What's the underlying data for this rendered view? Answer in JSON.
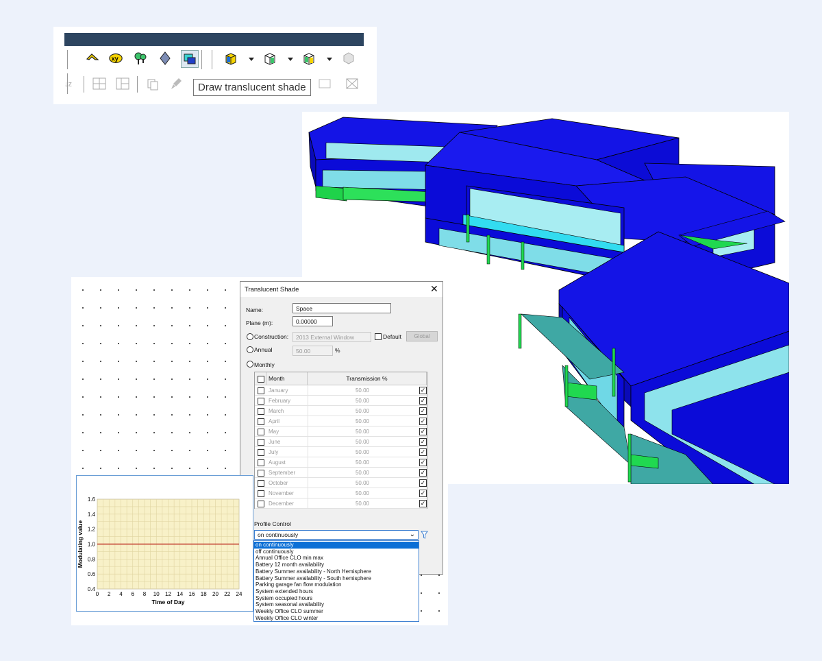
{
  "toolbar": {
    "tooltip": "Draw translucent shade",
    "icons": [
      "arrow-tool-icon",
      "xy-coordinate-icon",
      "tree-icon",
      "shade-diamond-icon",
      "translucent-shade-icon",
      "component-icon",
      "component-icon",
      "component-icon",
      "disabled-component-icon",
      "sort-icon",
      "layout-icon",
      "layout-icon",
      "copy-icon",
      "paint-icon",
      "tile-icon",
      "frame-icon"
    ]
  },
  "dialog": {
    "title": "Translucent Shade",
    "name_label": "Name:",
    "name_value": "Space",
    "plane_label": "Plane (m):",
    "plane_value": "0.00000",
    "construction_label": "Construction:",
    "construction_value": "2013 External Window",
    "default_label": "Default",
    "global_button": "Global",
    "annual_label": "Annual",
    "annual_value": "50.00",
    "percent_unit": "%",
    "monthly_label": "Monthly",
    "table_headers": {
      "month": "Month",
      "transmission": "Transmission %"
    },
    "months": [
      {
        "name": "January",
        "value": "50.00"
      },
      {
        "name": "February",
        "value": "50.00"
      },
      {
        "name": "March",
        "value": "50.00"
      },
      {
        "name": "April",
        "value": "50.00"
      },
      {
        "name": "May",
        "value": "50.00"
      },
      {
        "name": "June",
        "value": "50.00"
      },
      {
        "name": "July",
        "value": "50.00"
      },
      {
        "name": "August",
        "value": "50.00"
      },
      {
        "name": "September",
        "value": "50.00"
      },
      {
        "name": "October",
        "value": "50.00"
      },
      {
        "name": "November",
        "value": "50.00"
      },
      {
        "name": "December",
        "value": "50.00"
      }
    ],
    "checkmark": "✓",
    "close_glyph": "✕",
    "dropdown_glyph": "⌄",
    "profile_control_label": "Profile Control",
    "profile_selected": "on continuously",
    "profile_options": [
      "on continuously",
      "off continuously",
      "Annual Office CLO min max",
      "Battery 12 month availability",
      "Battery Summer availability - North Hemisphere",
      "Battery Summer availability - South hemisphere",
      "Parking garage fan flow modulation",
      "System extended hours",
      "System occupied hours",
      "System seasonal availability",
      "Weekly Office CLO summer",
      "Weekly Office CLO winter"
    ]
  },
  "chart_data": {
    "type": "line",
    "title": "",
    "xlabel": "Time of Day",
    "ylabel": "Modulating value",
    "x_ticks": [
      "0",
      "2",
      "4",
      "6",
      "8",
      "10",
      "12",
      "14",
      "16",
      "18",
      "20",
      "22",
      "24"
    ],
    "y_ticks": [
      "0.4",
      "0.6",
      "0.8",
      "1.0",
      "1.2",
      "1.4",
      "1.6"
    ],
    "xlim": [
      0,
      24
    ],
    "ylim": [
      0.4,
      1.6
    ],
    "grid": true,
    "series": [
      {
        "x": [
          0,
          24
        ],
        "y": [
          1.0,
          1.0
        ],
        "color": "#c0392b"
      }
    ],
    "colors": {
      "plot_background": "#f8f1c8",
      "grid": "#e0d4a0"
    }
  }
}
